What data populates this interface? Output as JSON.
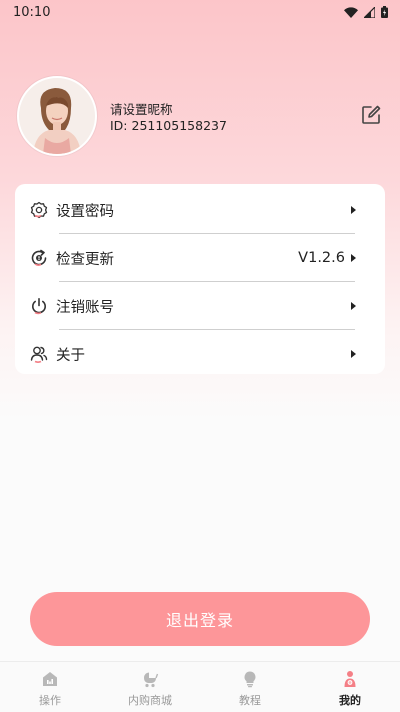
{
  "status_bar": {
    "time": "10:10"
  },
  "profile": {
    "nickname": "请设置昵称",
    "user_id": "ID: 251105158237"
  },
  "menu": [
    {
      "label": "设置密码",
      "value": "",
      "icon": "gear-icon"
    },
    {
      "label": "检查更新",
      "value": "V1.2.6",
      "icon": "update-icon"
    },
    {
      "label": "注销账号",
      "value": "",
      "icon": "power-icon"
    },
    {
      "label": "关于",
      "value": "",
      "icon": "users-icon"
    }
  ],
  "logout_label": "退出登录",
  "tabs": [
    {
      "label": "操作",
      "icon": "home-icon",
      "active": false
    },
    {
      "label": "内购商城",
      "icon": "stroller-icon",
      "active": false
    },
    {
      "label": "教程",
      "icon": "bulb-icon",
      "active": false
    },
    {
      "label": "我的",
      "icon": "mother-baby-icon",
      "active": true
    }
  ],
  "colors": {
    "accent": "#fd9699",
    "header_pink": "#fcc5c9",
    "icon_dot": "#f47f86"
  }
}
